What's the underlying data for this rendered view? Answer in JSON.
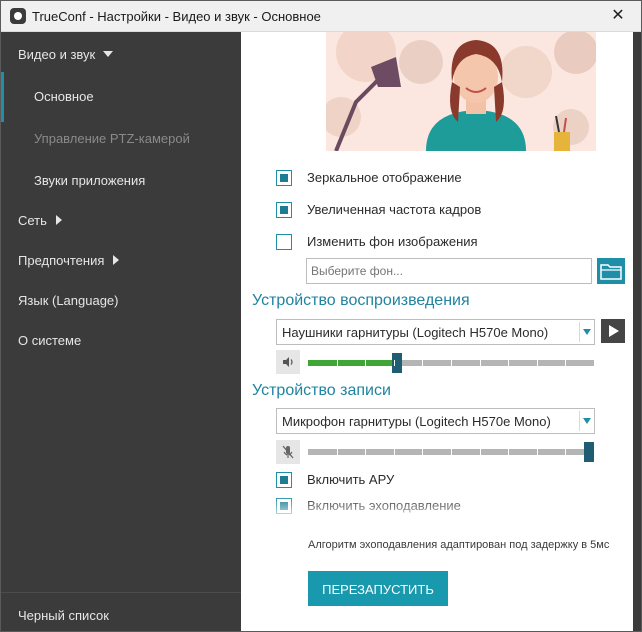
{
  "window": {
    "title": "TrueConf - Настройки - Видео и звук - Основное",
    "close_glyph": "✕"
  },
  "sidebar": {
    "items": [
      {
        "label": "Видео и звук",
        "expanded": true
      },
      {
        "label": "Основное",
        "active": true
      },
      {
        "label": "Управление PTZ-камерой",
        "disabled": true
      },
      {
        "label": "Звуки приложения"
      },
      {
        "label": "Сеть"
      },
      {
        "label": "Предпочтения"
      },
      {
        "label": "Язык (Language)"
      },
      {
        "label": "О системе"
      }
    ],
    "blacklist_label": "Черный список"
  },
  "video": {
    "mirror_label": "Зеркальное отображение",
    "mirror_checked": true,
    "hifps_label": "Увеличенная частота кадров",
    "hifps_checked": true,
    "bg_label": "Изменить фон изображения",
    "bg_checked": false,
    "bg_placeholder": "Выберите фон..."
  },
  "playback": {
    "title": "Устройство воспроизведения",
    "device": "Наушники гарнитуры (Logitech H570e Mono)",
    "volume_fraction": 0.31,
    "level_fraction": 0.31
  },
  "recording": {
    "title": "Устройство записи",
    "device": "Микрофон гарнитуры (Logitech H570e Mono)",
    "muted": true,
    "volume_fraction": 1.0,
    "agc_label": "Включить АРУ",
    "agc_checked": true,
    "aec_label": "Включить эхоподавление",
    "aec_checked": true
  },
  "aec_note": "Алгоритм эхоподавления адаптирован под задержку в 5мс",
  "restart_label": "ПЕРЕЗАПУСТИТЬ",
  "colors": {
    "accent": "#1f8fa7",
    "button": "#1899ad",
    "sidebar_bg": "#3b3b3b",
    "level_green": "#3fa535"
  },
  "icons": {
    "app": "trueconf-logo-icon",
    "folder": "folder-icon",
    "play": "play-icon",
    "speaker": "speaker-icon",
    "mic_muted": "microphone-muted-icon",
    "dropdown": "chevron-down-icon"
  }
}
